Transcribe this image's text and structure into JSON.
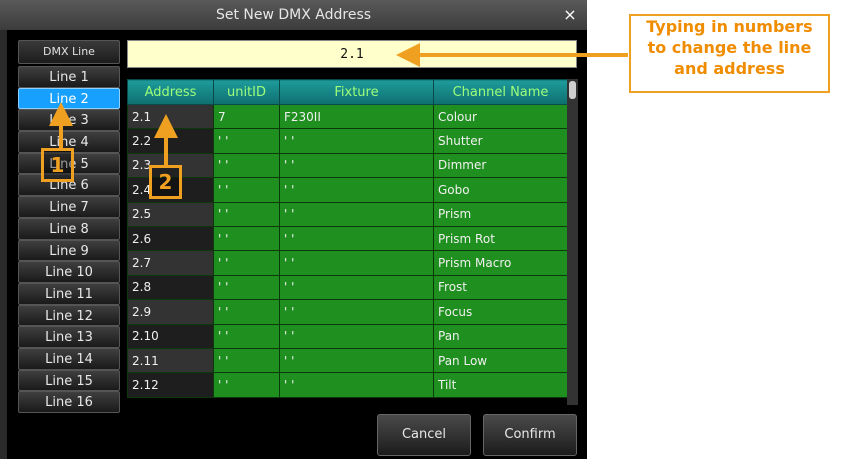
{
  "dialog": {
    "title": "Set New DMX Address",
    "close_glyph": "×"
  },
  "lines": {
    "header": "DMX Line",
    "items": [
      "Line 1",
      "Line 2",
      "Line 3",
      "Line 4",
      "Line 5",
      "Line 6",
      "Line 7",
      "Line 8",
      "Line 9",
      "Line 10",
      "Line 11",
      "Line 12",
      "Line 13",
      "Line 14",
      "Line 15",
      "Line 16"
    ],
    "selected_index": 1
  },
  "address_input": {
    "value": "2.1"
  },
  "grid": {
    "columns": [
      "Address",
      "unitID",
      "Fixture",
      "Channel Name"
    ],
    "rows": [
      [
        "2.1",
        "7",
        "F230II",
        "Colour"
      ],
      [
        "2.2",
        "' '",
        "' '",
        "Shutter"
      ],
      [
        "2.3",
        "' '",
        "' '",
        "Dimmer"
      ],
      [
        "2.4",
        "' '",
        "' '",
        "Gobo"
      ],
      [
        "2.5",
        "' '",
        "' '",
        "Prism"
      ],
      [
        "2.6",
        "' '",
        "' '",
        "Prism Rot"
      ],
      [
        "2.7",
        "' '",
        "' '",
        "Prism Macro"
      ],
      [
        "2.8",
        "' '",
        "' '",
        "Frost"
      ],
      [
        "2.9",
        "' '",
        "' '",
        "Focus"
      ],
      [
        "2.10",
        "' '",
        "' '",
        "Pan"
      ],
      [
        "2.11",
        "' '",
        "' '",
        "Pan Low"
      ],
      [
        "2.12",
        "' '",
        "' '",
        "Tilt"
      ]
    ]
  },
  "buttons": {
    "cancel": "Cancel",
    "confirm": "Confirm"
  },
  "markers": {
    "one": "1",
    "two": "2"
  },
  "callout": {
    "line1": "Typing in numbers",
    "line2": "to change the line",
    "line3": "and address"
  },
  "colors": {
    "accent": "#f0a020",
    "selected_line": "#18a0ff",
    "grid_green": "#1f8f1f",
    "input_bg": "#ffffcc"
  }
}
